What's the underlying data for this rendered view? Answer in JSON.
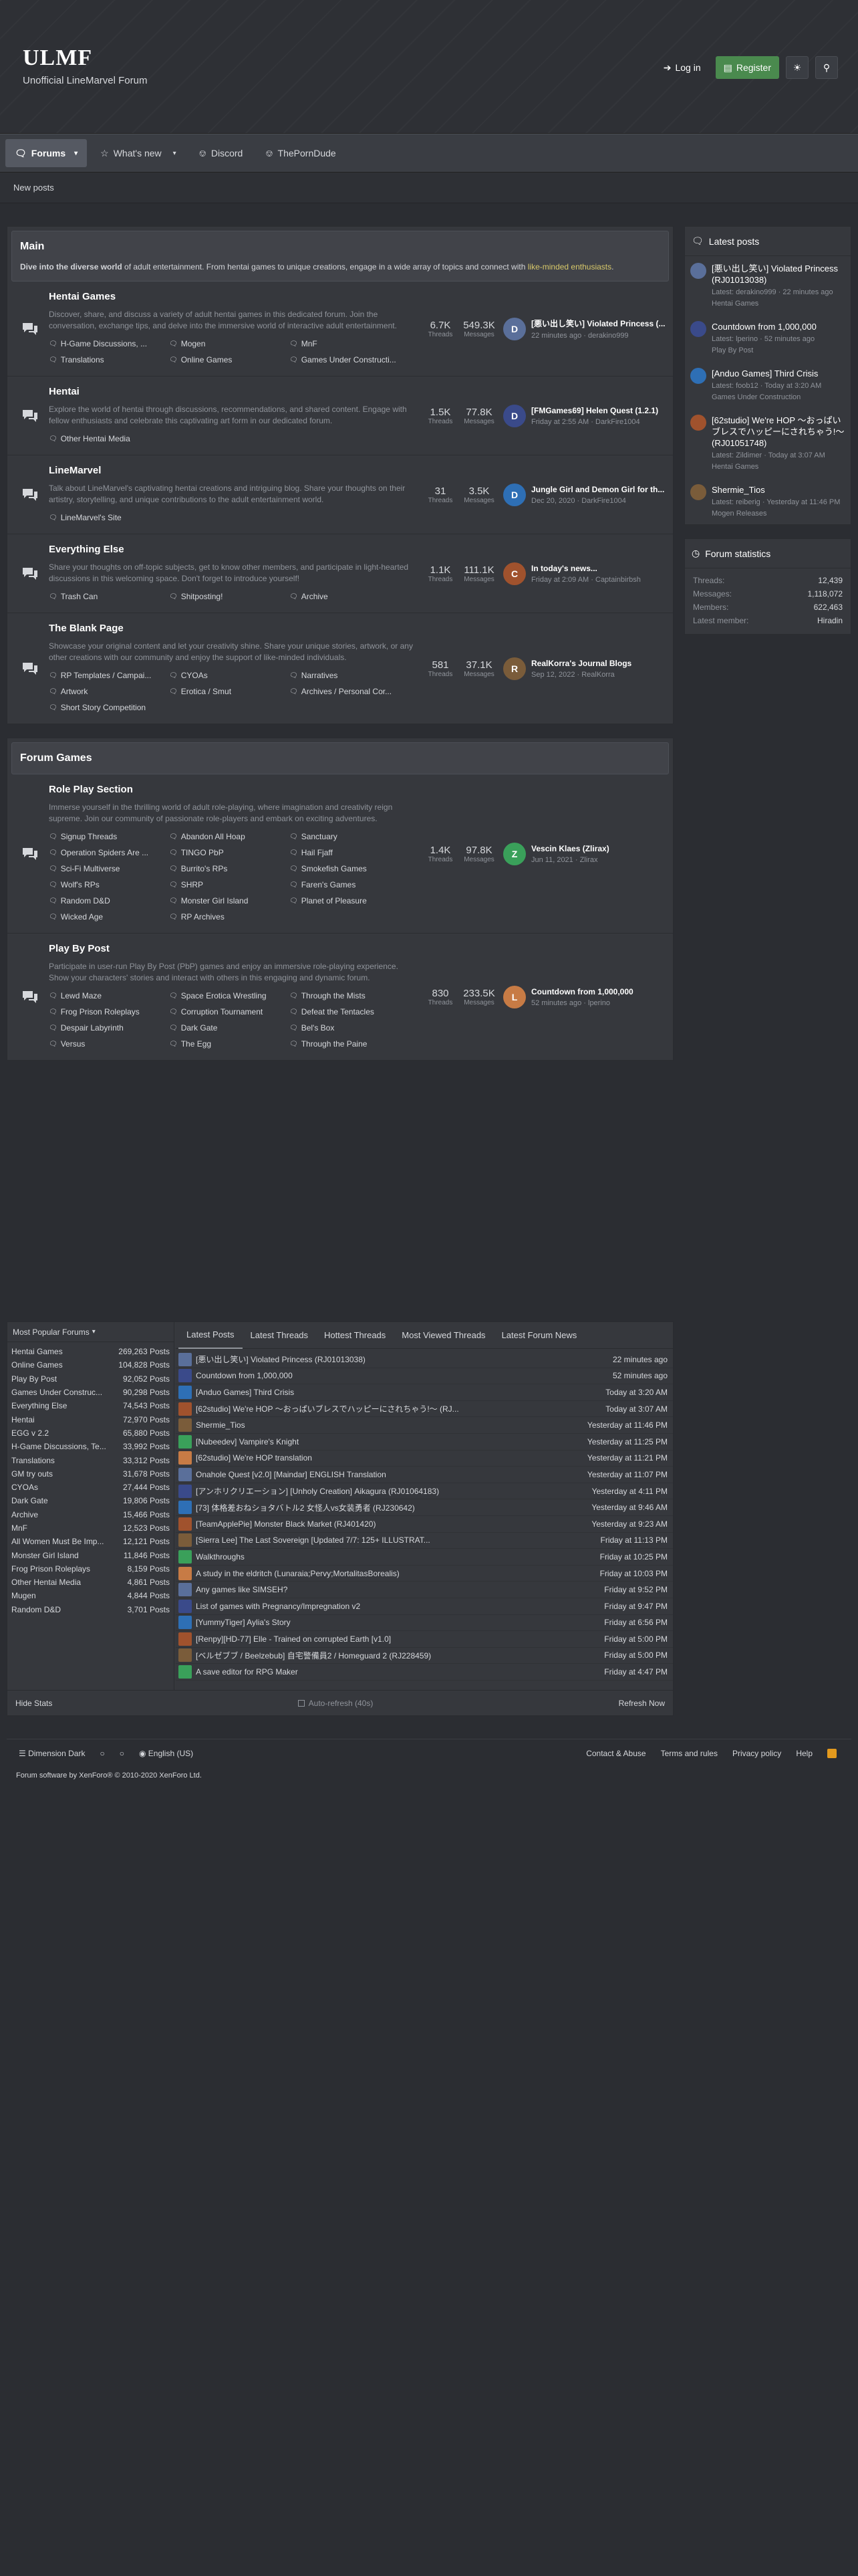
{
  "site": {
    "title": "ULMF",
    "tagline": "Unofficial LineMarvel Forum"
  },
  "header_buttons": {
    "login": "Log in",
    "register": "Register"
  },
  "nav": {
    "forums": "Forums",
    "whats_new": "What's new",
    "discord": "Discord",
    "porndude": "ThePornDude"
  },
  "subnav": {
    "new_posts": "New posts"
  },
  "main_cat": {
    "title": "Main",
    "desc_a": "Dive into the diverse world",
    "desc_b": " of adult entertainment. From hentai games to unique creations, engage in a wide array of topics and connect with ",
    "desc_c": "like-minded enthusiasts",
    "desc_d": "."
  },
  "nodes": [
    {
      "title": "Hentai Games",
      "desc": "Discover, share, and discuss a variety of adult hentai games in this dedicated forum. Join the conversation, exchange tips, and delve into the immersive world of interactive adult entertainment.",
      "subs": [
        "H-Game Discussions, ...",
        "Mogen",
        "MnF",
        "Translations",
        "Online Games",
        "Games Under Constructi..."
      ],
      "threads": "6.7K",
      "messages": "549.3K",
      "last_title": "[悪い出し笑い] Violated Princess (...",
      "last_time": "22 minutes ago",
      "last_user": "derakino999"
    },
    {
      "title": "Hentai",
      "desc": "Explore the world of hentai through discussions, recommendations, and shared content. Engage with fellow enthusiasts and celebrate this captivating art form in our dedicated forum.",
      "subs": [
        "Other Hentai Media"
      ],
      "threads": "1.5K",
      "messages": "77.8K",
      "last_title": "[FMGames69] Helen Quest (1.2.1)",
      "last_time": "Friday at 2:55 AM",
      "last_user": "DarkFire1004"
    },
    {
      "title": "LineMarvel",
      "desc": "Talk about LineMarvel's captivating hentai creations and intriguing blog. Share your thoughts on their artistry, storytelling, and unique contributions to the adult entertainment world.",
      "subs": [
        "LineMarvel's Site"
      ],
      "threads": "31",
      "messages": "3.5K",
      "last_title": "Jungle Girl and Demon Girl for th...",
      "last_time": "Dec 20, 2020",
      "last_user": "DarkFire1004"
    },
    {
      "title": "Everything Else",
      "desc": "Share your thoughts on off-topic subjects, get to know other members, and participate in light-hearted discussions in this welcoming space. Don't forget to introduce yourself!",
      "subs": [
        "Trash Can",
        "Shitposting!",
        "Archive"
      ],
      "threads": "1.1K",
      "messages": "111.1K",
      "last_title": "In today's news...",
      "last_time": "Friday at 2:09 AM",
      "last_user": "Captainbirbsh"
    },
    {
      "title": "The Blank Page",
      "desc": "Showcase your original content and let your creativity shine. Share your unique stories, artwork, or any other creations with our community and enjoy the support of like-minded individuals.",
      "subs": [
        "RP Templates / Campai...",
        "CYOAs",
        "Narratives",
        "Artwork",
        "Erotica / Smut",
        "Archives / Personal Cor...",
        "Short Story Competition"
      ],
      "threads": "581",
      "messages": "37.1K",
      "last_title": "RealKorra's Journal Blogs",
      "last_time": "Sep 12, 2022",
      "last_user": "RealKorra"
    }
  ],
  "games_cat": {
    "title": "Forum Games"
  },
  "game_nodes": [
    {
      "title": "Role Play Section",
      "desc": "Immerse yourself in the thrilling world of adult role-playing, where imagination and creativity reign supreme. Join our community of passionate role-players and embark on exciting adventures.",
      "subs": [
        "Signup Threads",
        "Abandon All Hoap",
        "Sanctuary",
        "Operation Spiders Are ...",
        "TINGO PbP",
        "Hail Fjaff",
        "Sci-Fi Multiverse",
        "Burrito's RPs",
        "Smokefish Games",
        "Wolf's RPs",
        "SHRP",
        "Faren's Games",
        "Random D&D",
        "Monster Girl Island",
        "Planet of Pleasure",
        "Wicked Age",
        "RP Archives"
      ],
      "threads": "1.4K",
      "messages": "97.8K",
      "last_title": "Vescin Klaes (Zlirax)",
      "last_time": "Jun 11, 2021",
      "last_user": "Zlirax"
    },
    {
      "title": "Play By Post",
      "desc": "Participate in user-run Play By Post (PbP) games and enjoy an immersive role-playing experience. Show your characters' stories and interact with others in this engaging and dynamic forum.",
      "subs": [
        "Lewd Maze",
        "Space Erotica Wrestling",
        "Through the Mists",
        "Frog Prison Roleplays",
        "Corruption Tournament",
        "Defeat the Tentacles",
        "Despair Labyrinth",
        "Dark Gate",
        "Bel's Box",
        "Versus",
        "The Egg",
        "Through the Paine"
      ],
      "threads": "830",
      "messages": "233.5K",
      "last_title": "Countdown from 1,000,000",
      "last_time": "52 minutes ago",
      "last_user": "lperino"
    }
  ],
  "latest_posts": {
    "heading": "Latest posts",
    "items": [
      {
        "title": "[悪い出し笑い] Violated Princess (RJ01013038)",
        "meta": "Latest: derakino999 · 22 minutes ago",
        "forum": "Hentai Games"
      },
      {
        "title": "Countdown from 1,000,000",
        "meta": "Latest: lperino · 52 minutes ago",
        "forum": "Play By Post"
      },
      {
        "title": "[Anduo Games] Third Crisis",
        "meta": "Latest: foob12 · Today at 3:20 AM",
        "forum": "Games Under Construction"
      },
      {
        "title": "[62studio] We're HOP 〜おっぱいブレスでハッピーにされちゃう!〜 (RJ01051748)",
        "meta": "Latest: Zildimer · Today at 3:07 AM",
        "forum": "Hentai Games"
      },
      {
        "title": "Shermie_Tios",
        "meta": "Latest: reiberig · Yesterday at 11:46 PM",
        "forum": "Mogen Releases"
      }
    ]
  },
  "forum_stats": {
    "heading": "Forum statistics",
    "rows": [
      {
        "k": "Threads:",
        "v": "12,439"
      },
      {
        "k": "Messages:",
        "v": "1,118,072"
      },
      {
        "k": "Members:",
        "v": "622,463"
      },
      {
        "k": "Latest member:",
        "v": "Hiradin"
      }
    ]
  },
  "popular": {
    "heading": "Most Popular Forums",
    "rows": [
      {
        "k": "Hentai Games",
        "v": "269,263 Posts"
      },
      {
        "k": "Online Games",
        "v": "104,828 Posts"
      },
      {
        "k": "Play By Post",
        "v": "92,052 Posts"
      },
      {
        "k": "Games Under Construc...",
        "v": "90,298 Posts"
      },
      {
        "k": "Everything Else",
        "v": "74,543 Posts"
      },
      {
        "k": "Hentai",
        "v": "72,970 Posts"
      },
      {
        "k": "EGG v 2.2",
        "v": "65,880 Posts"
      },
      {
        "k": "H-Game Discussions, Te...",
        "v": "33,992 Posts"
      },
      {
        "k": "Translations",
        "v": "33,312 Posts"
      },
      {
        "k": "GM try outs",
        "v": "31,678 Posts"
      },
      {
        "k": "CYOAs",
        "v": "27,444 Posts"
      },
      {
        "k": "Dark Gate",
        "v": "19,806 Posts"
      },
      {
        "k": "Archive",
        "v": "15,466 Posts"
      },
      {
        "k": "MnF",
        "v": "12,523 Posts"
      },
      {
        "k": "All Women Must Be Imp...",
        "v": "12,121 Posts"
      },
      {
        "k": "Monster Girl Island",
        "v": "11,846 Posts"
      },
      {
        "k": "Frog Prison Roleplays",
        "v": "8,159 Posts"
      },
      {
        "k": "Other Hentai Media",
        "v": "4,861 Posts"
      },
      {
        "k": "Mugen",
        "v": "4,844 Posts"
      },
      {
        "k": "Random D&D",
        "v": "3,701 Posts"
      }
    ]
  },
  "thread_tabs": [
    "Latest Posts",
    "Latest Threads",
    "Hottest Threads",
    "Most Viewed Threads",
    "Latest Forum News"
  ],
  "threads": [
    {
      "t": "[悪い出し笑い] Violated Princess (RJ01013038)",
      "m": "22 minutes ago"
    },
    {
      "t": "Countdown from 1,000,000",
      "m": "52 minutes ago"
    },
    {
      "t": "[Anduo Games] Third Crisis",
      "m": "Today at 3:20 AM"
    },
    {
      "t": "[62studio] We're HOP 〜おっぱいブレスでハッピーにされちゃう!〜 (RJ...",
      "m": "Today at 3:07 AM"
    },
    {
      "t": "Shermie_Tios",
      "m": "Yesterday at 11:46 PM"
    },
    {
      "t": "[Nubeedev] Vampire's Knight",
      "m": "Yesterday at 11:25 PM"
    },
    {
      "t": "[62studio] We're HOP translation",
      "m": "Yesterday at 11:21 PM"
    },
    {
      "t": "Onahole Quest [v2.0] [Maindar] ENGLISH Translation",
      "m": "Yesterday at 11:07 PM"
    },
    {
      "t": "[アンホリクリエーション] [Unholy Creation] Aikagura (RJ01064183)",
      "m": "Yesterday at 4:11 PM"
    },
    {
      "t": "[73] 体格差おねショタバトル2 女怪人vs女装勇者 (RJ230642)",
      "m": "Yesterday at 9:46 AM"
    },
    {
      "t": "[TeamApplePie] Monster Black Market (RJ401420)",
      "m": "Yesterday at 9:23 AM"
    },
    {
      "t": "[Sierra Lee] The Last Sovereign [Updated 7/7: 125+ ILLUSTRAT...",
      "m": "Friday at 11:13 PM"
    },
    {
      "t": "Walkthroughs",
      "m": "Friday at 10:25 PM"
    },
    {
      "t": "A study in the eldritch (Lunaraia;Pervy;MortalitasBorealis)",
      "m": "Friday at 10:03 PM"
    },
    {
      "t": "Any games like SIMSEH?",
      "m": "Friday at 9:52 PM"
    },
    {
      "t": "List of games with Pregnancy/Impregnation v2",
      "m": "Friday at 9:47 PM"
    },
    {
      "t": "[YummyTiger] Aylia's Story",
      "m": "Friday at 6:56 PM"
    },
    {
      "t": "[Renpy][HD-77] Elle - Trained on corrupted Earth [v1.0]",
      "m": "Friday at 5:00 PM"
    },
    {
      "t": "[ベルゼブブ / Beelzebub] 自宅警備員2 / Homeguard 2 (RJ228459)",
      "m": "Friday at 5:00 PM"
    },
    {
      "t": "A save editor for RPG Maker",
      "m": "Friday at 4:47 PM"
    }
  ],
  "bottom_bar": {
    "hide": "Hide Stats",
    "auto": "Auto-refresh (40s)",
    "refresh": "Refresh Now"
  },
  "footer": {
    "style": "Dimension Dark",
    "lang": "English (US)",
    "contact": "Contact & Abuse",
    "terms": "Terms and rules",
    "privacy": "Privacy policy",
    "help": "Help",
    "copyright": "Forum software by XenForo® © 2010-2020 XenForo Ltd."
  },
  "labels": {
    "threads": "Threads",
    "messages": "Messages"
  }
}
